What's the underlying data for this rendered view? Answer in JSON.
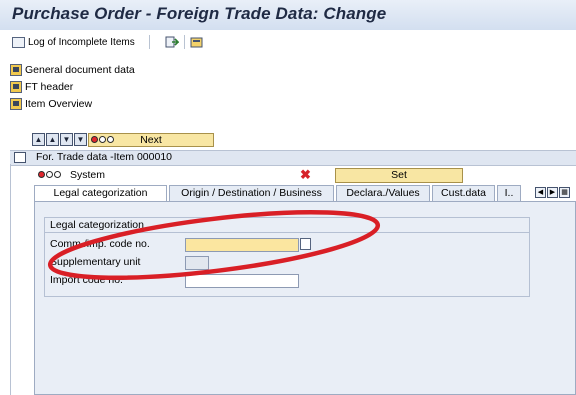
{
  "window": {
    "title": "Purchase Order - Foreign Trade Data: Change"
  },
  "toolbar": {
    "incomplete_log_label": "Log of Incomplete Items"
  },
  "header_sections": [
    {
      "label": "General document data"
    },
    {
      "label": "FT header"
    },
    {
      "label": "Item Overview"
    }
  ],
  "item_nav": {
    "next_label": "Next"
  },
  "section": {
    "label": "For. Trade data -Item 000010"
  },
  "system_row": {
    "label": "System",
    "set_label": "Set"
  },
  "tabs": [
    {
      "label": "Legal categorization",
      "active": true
    },
    {
      "label": "Origin / Destination / Business",
      "active": false
    },
    {
      "label": "Declara./Values",
      "active": false
    },
    {
      "label": "Cust.data",
      "active": false
    },
    {
      "label": "I..",
      "active": false
    }
  ],
  "legal_group": {
    "title": "Legal categorization",
    "fields": [
      {
        "label": "Comm./imp. code no.",
        "value": "",
        "required": true
      },
      {
        "label": "Supplementary unit",
        "value": "",
        "readonly": true
      },
      {
        "label": "Import code no.",
        "value": ""
      }
    ]
  },
  "colors": {
    "title_text": "#1f2a44",
    "required_field": "#fbe6a0",
    "annotation_ellipse": "#d91f26",
    "panel_bg": "#e9eef6"
  }
}
